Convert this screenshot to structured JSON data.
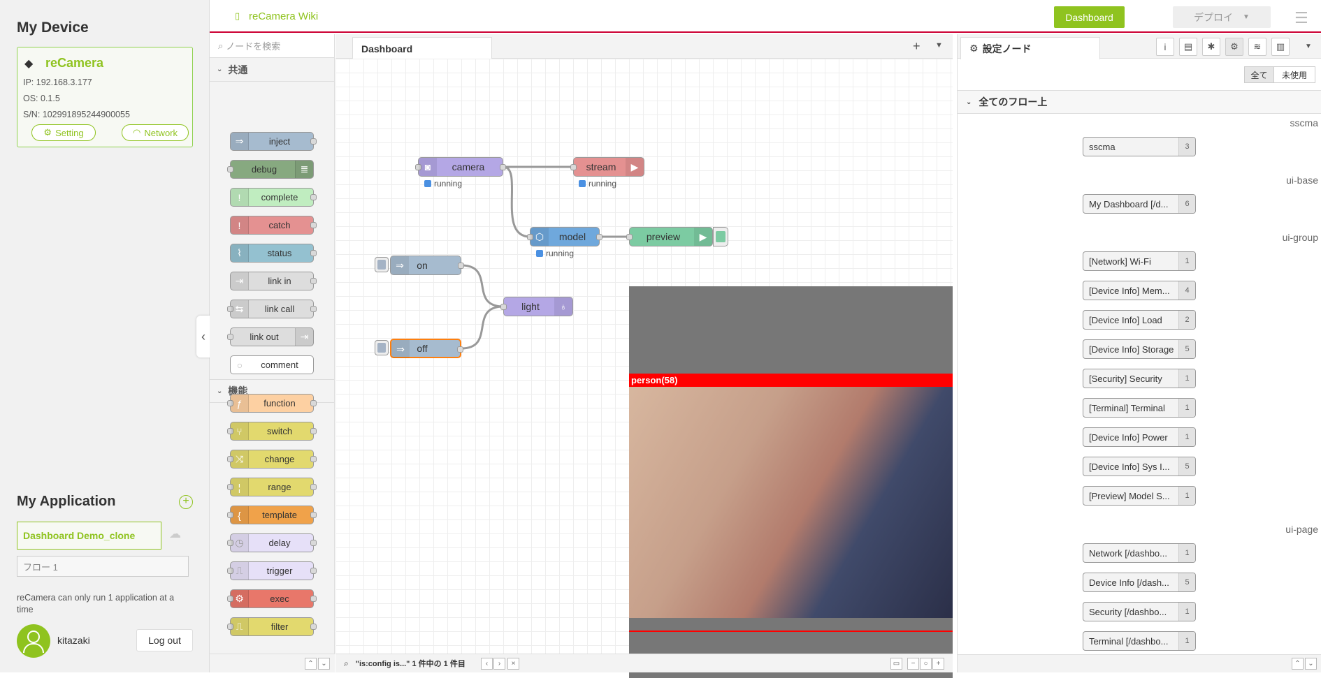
{
  "left_panel": {
    "device_heading": "My Device",
    "device_name": "reCamera",
    "ip": "IP:  192.168.3.177",
    "os": "OS:  0.1.5",
    "sn": "S/N:  102991895244900055",
    "setting_label": "Setting",
    "network_label": "Network",
    "app_heading": "My Application",
    "app_name": "Dashboard Demo_clone",
    "flow_name": "フロー 1",
    "note": "reCamera can only run 1 application at a time",
    "username": "kitazaki",
    "logout_label": "Log out"
  },
  "header": {
    "wiki_label": "reCamera Wiki",
    "dashboard_button": "Dashboard",
    "deploy_button": "デプロイ"
  },
  "palette": {
    "search_placeholder": "ノードを検索",
    "categories": [
      "共通",
      "機能"
    ],
    "common_nodes": [
      "inject",
      "debug",
      "complete",
      "catch",
      "status",
      "link in",
      "link call",
      "link out",
      "comment"
    ],
    "function_nodes": [
      "function",
      "switch",
      "change",
      "range",
      "template",
      "delay",
      "trigger",
      "exec",
      "filter"
    ],
    "colors": {
      "inject": "#a6bbcf",
      "debug": "#87a980",
      "complete": "#c0edc0",
      "catch": "#e49191",
      "status": "#94c1d0",
      "link": "#dddddd",
      "comment": "#ffffff",
      "function": "#fdd0a2",
      "switch": "#e2d96e",
      "template": "#f0a24a",
      "delay": "#e6e0f8",
      "exec": "#e8776a"
    }
  },
  "workspace": {
    "tab_label": "Dashboard",
    "nodes": {
      "camera": "camera",
      "stream": "stream",
      "model": "model",
      "preview": "preview",
      "on": "on",
      "off": "off",
      "light": "light"
    },
    "status_text": "running",
    "detection_label": "person(58)",
    "footer_search": "\"is:config is...\" 1 件中の 1 件目"
  },
  "sidebar": {
    "tab_label": "設定ノード",
    "filter_all": "全て",
    "filter_unused": "未使用",
    "section_label": "全てのフロー上",
    "groups": [
      {
        "type": "sscma",
        "items": [
          {
            "label": "sscma",
            "count": "3"
          }
        ]
      },
      {
        "type": "ui-base",
        "items": [
          {
            "label": "My Dashboard [/d...",
            "count": "6"
          }
        ]
      },
      {
        "type": "ui-group",
        "items": [
          {
            "label": "[Network] Wi-Fi",
            "count": "1"
          },
          {
            "label": "[Device Info] Mem...",
            "count": "4"
          },
          {
            "label": "[Device Info] Load",
            "count": "2"
          },
          {
            "label": "[Device Info] Storage",
            "count": "5"
          },
          {
            "label": "[Security] Security",
            "count": "1"
          },
          {
            "label": "[Terminal] Terminal",
            "count": "1"
          },
          {
            "label": "[Device Info] Power",
            "count": "1"
          },
          {
            "label": "[Device Info] Sys I...",
            "count": "5"
          },
          {
            "label": "[Preview] Model S...",
            "count": "1"
          }
        ]
      },
      {
        "type": "ui-page",
        "items": [
          {
            "label": "Network [/dashbo...",
            "count": "1"
          },
          {
            "label": "Device Info [/dash...",
            "count": "5"
          },
          {
            "label": "Security [/dashbo...",
            "count": "1"
          },
          {
            "label": "Terminal [/dashbo...",
            "count": "1"
          }
        ]
      }
    ]
  }
}
